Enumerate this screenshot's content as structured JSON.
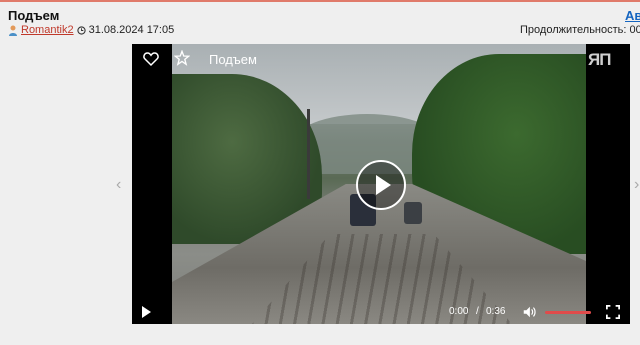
{
  "post": {
    "title": "Подъем",
    "author": "Romantik2",
    "datetime": "31.08.2024 17:05",
    "right_link": "Ав",
    "duration_label": "Продолжительность: 00"
  },
  "video": {
    "title": "Подъем",
    "logo": "ЯП",
    "current_time": "0:00",
    "separator": "/",
    "total_time": "0:36",
    "progress": 0,
    "volume": 1.0
  },
  "nav": {
    "prev_arrow": "‹",
    "next_arrow": "›"
  },
  "colors": {
    "author_link": "#c0392b",
    "right_link": "#1565c0",
    "volume_bar": "#e04b4b"
  }
}
